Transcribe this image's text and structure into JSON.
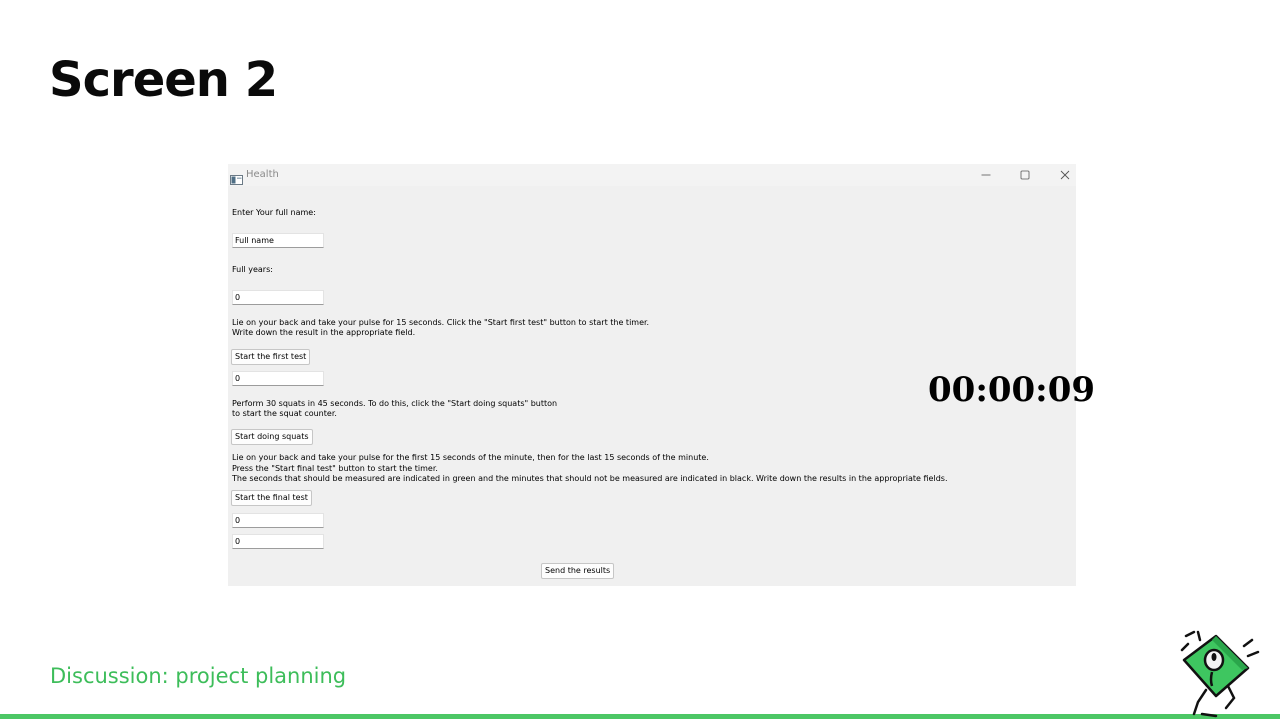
{
  "slide": {
    "title": "Screen 2",
    "footer": "Discussion: project planning"
  },
  "window": {
    "title": "Health",
    "icon": "app-window-icon",
    "controls": [
      "minimize-icon",
      "maximize-icon",
      "close-icon"
    ]
  },
  "form": {
    "name_label": "Enter Your full name:",
    "name_value": "Full name",
    "age_label": "Full years:",
    "age_value": "0",
    "instruction1_line1": "Lie on your back and take your pulse for 15 seconds. Click the \"Start first test\" button to start the timer.",
    "instruction1_line2": "Write down the result in the appropriate field.",
    "start_first_test_label": "Start the first test",
    "first_test_value": "0",
    "instruction2_line1": "Perform 30 squats in 45 seconds. To do this, click the \"Start doing squats\" button",
    "instruction2_line2": "to start the squat counter.",
    "start_squats_label": "Start doing squats",
    "instruction3_line1": "Lie on your back and take your pulse for the first 15 seconds of the minute, then for the last 15 seconds of the minute.",
    "instruction3_line2": "Press the \"Start final test\" button to start the timer.",
    "instruction3_line3": "The seconds that should be measured are indicated in green and the minutes that should not be measured are indicated in black. Write down the results in the appropriate fields.",
    "start_final_test_label": "Start the final test",
    "final_test_value1": "0",
    "final_test_value2": "0",
    "send_results_label": "Send the results"
  },
  "timer": {
    "value": "00:00:09"
  },
  "colors": {
    "accent_green": "#3dbd5a",
    "window_bg": "#f0f0f0",
    "title_text": "#0a0a0a"
  }
}
